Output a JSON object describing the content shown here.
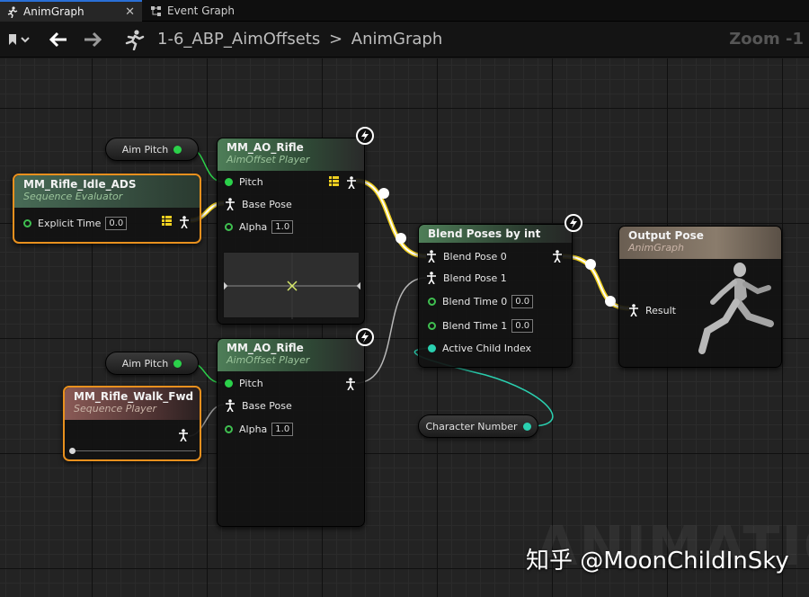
{
  "tabs": [
    {
      "label": "AnimGraph",
      "icon": "running-man-icon",
      "active": true
    },
    {
      "label": "Event Graph",
      "icon": "event-graph-icon",
      "active": false
    }
  ],
  "toolbar": {
    "breadcrumb_asset": "1-6_ABP_AimOffsets",
    "breadcrumb_sep": ">",
    "breadcrumb_graph": "AnimGraph",
    "zoom": "Zoom -1"
  },
  "nodes": {
    "aim_pitch_1": {
      "label": "Aim Pitch"
    },
    "aim_pitch_2": {
      "label": "Aim Pitch"
    },
    "seq_eval": {
      "title": "MM_Rifle_Idle_ADS",
      "subtitle": "Sequence Evaluator",
      "pin_explicit_time": "Explicit Time",
      "explicit_time_value": "0.0"
    },
    "ao_rifle_1": {
      "title": "MM_AO_Rifle",
      "subtitle": "AimOffset Player",
      "pin_pitch": "Pitch",
      "pin_base_pose": "Base Pose",
      "pin_alpha": "Alpha",
      "alpha_value": "1.0"
    },
    "ao_rifle_2": {
      "title": "MM_AO_Rifle",
      "subtitle": "AimOffset Player",
      "pin_pitch": "Pitch",
      "pin_base_pose": "Base Pose",
      "pin_alpha": "Alpha",
      "alpha_value": "1.0"
    },
    "seq_player": {
      "title": "MM_Rifle_Walk_Fwd",
      "subtitle": "Sequence Player"
    },
    "blend": {
      "title": "Blend Poses by int",
      "pin_blend_pose_0": "Blend Pose 0",
      "pin_blend_pose_1": "Blend Pose 1",
      "pin_blend_time_0": "Blend Time 0",
      "blend_time_0_value": "0.0",
      "pin_blend_time_1": "Blend Time 1",
      "blend_time_1_value": "0.0",
      "pin_active_child": "Active Child Index"
    },
    "character_number": {
      "label": "Character Number"
    },
    "output_pose": {
      "title": "Output Pose",
      "subtitle": "AnimGraph",
      "pin_result": "Result"
    }
  },
  "watermark": {
    "text": "知乎 @MoonChildInSky",
    "bg_text": "ANIMATION"
  },
  "colors": {
    "exec_wire": "#f0d020",
    "float_pin": "#2bd14a",
    "int_pin": "#2ad0b0",
    "selected_outline": "#e8901e",
    "tab_active": "#2a6fd6"
  }
}
